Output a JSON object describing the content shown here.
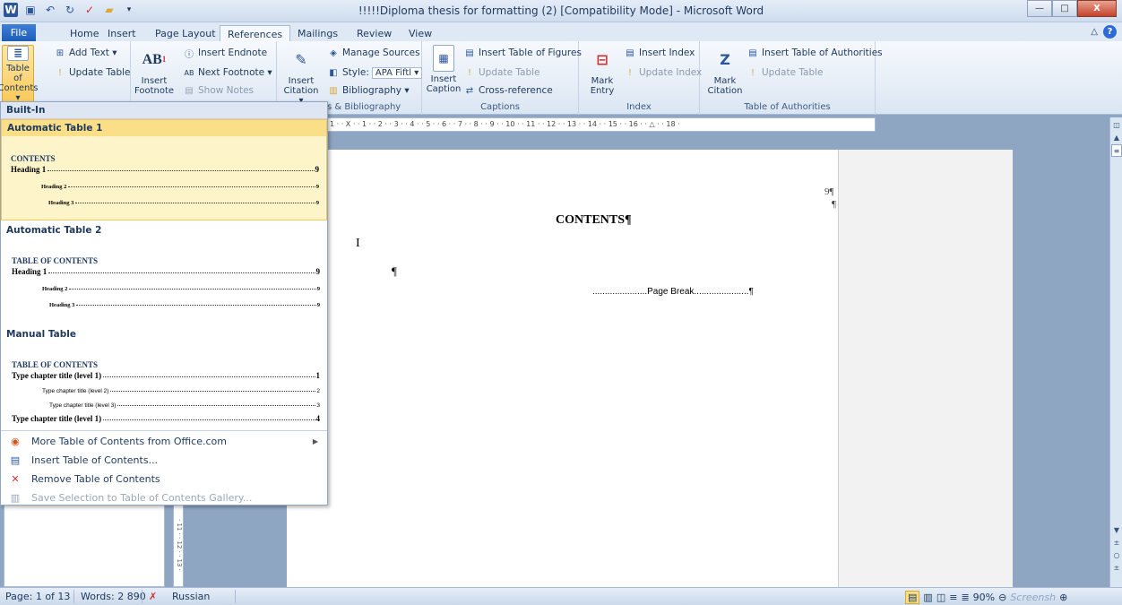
{
  "window": {
    "title": "!!!!!Diploma thesis for formatting (2) [Compatibility Mode] - Microsoft Word",
    "minimize": "—",
    "maximize": "□",
    "close": "X"
  },
  "tabs": [
    "File",
    "Home",
    "Insert",
    "Page Layout",
    "References",
    "Mailings",
    "Review",
    "View"
  ],
  "ribbon": {
    "toc_group": {
      "toc_line1": "Table of",
      "toc_line2": "Contents ▾",
      "add_text": "Add Text ▾",
      "update_table": "Update Table"
    },
    "footnotes": {
      "insert_footnote_line1": "Insert",
      "insert_footnote_line2": "Footnote",
      "insert_endnote": "Insert Endnote",
      "next_footnote": "Next Footnote ▾",
      "show_notes": "Show Notes",
      "ab_icon": "AB"
    },
    "citations": {
      "insert_citation_line1": "Insert",
      "insert_citation_line2": "Citation ▾",
      "manage_sources": "Manage Sources",
      "style_label": "Style:",
      "style_value": "APA Fiftl ▾",
      "bibliography": "Bibliography ▾",
      "group_label": "s & Bibliography"
    },
    "captions": {
      "insert_caption_line1": "Insert",
      "insert_caption_line2": "Caption",
      "insert_table_of_figures": "Insert Table of Figures",
      "update_table": "Update Table",
      "cross_reference": "Cross-reference",
      "group_label": "Captions"
    },
    "index": {
      "mark_entry_line1": "Mark",
      "mark_entry_line2": "Entry",
      "insert_index": "Insert Index",
      "update_index": "Update Index",
      "group_label": "Index"
    },
    "authorities": {
      "mark_citation_line1": "Mark",
      "mark_citation_line2": "Citation",
      "insert_table_of_authorities": "Insert Table of Authorities",
      "update_table": "Update Table",
      "group_label": "Table of Authorities"
    }
  },
  "ruler": {
    "marks": "1 · · X · · 1 · · 2 · · 3 · · 4 · · 5 · · 6 · · 7 · · 8 · · 9 · · 10 · · 11 · · 12 · · 13 · · 14 · · 15 · · 16 · · △ · · 18 ·"
  },
  "gallery": {
    "header": "Built-In",
    "auto1": {
      "title": "Automatic Table 1",
      "heading": "CONTENTS",
      "lines": [
        {
          "label": "Heading 1",
          "num": "9"
        },
        {
          "label": "Heading 2",
          "num": "9"
        },
        {
          "label": "Heading 3",
          "num": "9"
        }
      ]
    },
    "auto2": {
      "title": "Automatic Table 2",
      "heading": "TABLE OF CONTENTS",
      "lines": [
        {
          "label": "Heading 1",
          "num": "9"
        },
        {
          "label": "Heading 2",
          "num": "9"
        },
        {
          "label": "Heading 3",
          "num": "9"
        }
      ]
    },
    "manual": {
      "title": "Manual Table",
      "heading": "TABLE OF CONTENTS",
      "lines": [
        {
          "label": "Type chapter title (level 1)",
          "num": "1"
        },
        {
          "label": "Type chapter title (level 2)",
          "num": "2"
        },
        {
          "label": "Type chapter title (level 3)",
          "num": "3"
        },
        {
          "label": "Type chapter title (level 1)",
          "num": "4"
        }
      ]
    },
    "commands": {
      "more_toc": "More Table of Contents from Office.com",
      "insert_toc": "Insert Table of Contents...",
      "remove_toc": "Remove Table of Contents",
      "save_selection": "Save Selection to Table of Contents Gallery..."
    }
  },
  "document": {
    "page_num": "9¶",
    "para_mark": "¶",
    "contents_heading": "CONTENTS¶",
    "cursor": "I",
    "pilcrow": "¶",
    "page_break_dots_left": "......................",
    "page_break": "Page Break",
    "page_break_dots_right": "......................¶"
  },
  "statusbar": {
    "page": "Page: 1 of 13",
    "words": "Words: 2 890",
    "language": "Russian",
    "zoom": "90%",
    "watermark": "Screensh"
  },
  "colors": {
    "accent_blue": "#2b579a",
    "hover_yellow": "#fbdf88"
  }
}
